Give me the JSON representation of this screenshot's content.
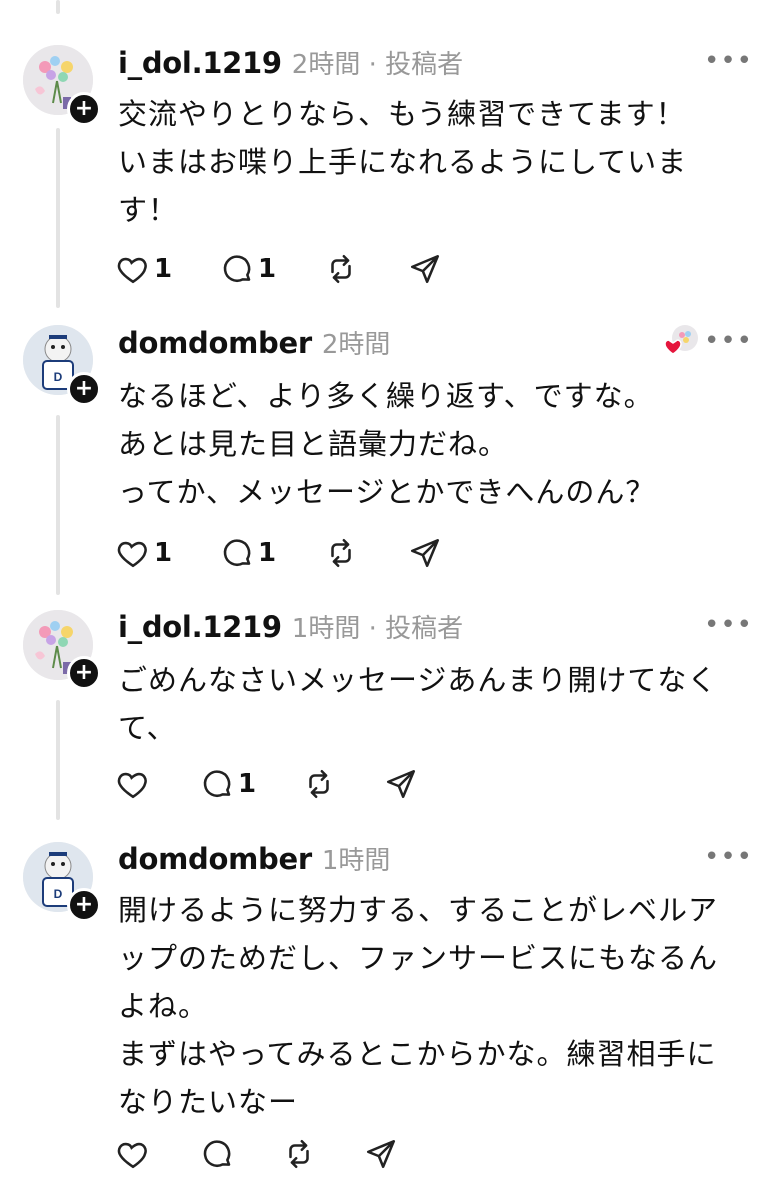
{
  "posts": [
    {
      "username": "i_dol.1219",
      "meta": "2時間 · 投稿者",
      "text": "交流やりとりなら、もう練習できてます！\nいまはお喋り上手になれるようにしていま\nす！",
      "likes": "1",
      "replies": "1",
      "avatar": "bouquet-avatar"
    },
    {
      "username": "domdomber",
      "meta": "2時間",
      "text": "なるほど、より多く繰り返す、ですな。\nあとは見た目と語彙力だね。\nってか、メッセージとかできへんのん？",
      "likes": "1",
      "replies": "1",
      "avatar": "mascot-avatar",
      "liked_by_author": true
    },
    {
      "username": "i_dol.1219",
      "meta": "1時間 · 投稿者",
      "text": "ごめんなさいメッセージあんまり開けてなく\nて、",
      "likes": "",
      "replies": "1",
      "avatar": "bouquet-avatar"
    },
    {
      "username": "domdomber",
      "meta": "1時間",
      "text": "開けるように努力する、することがレベルア\nップのためだし、ファンサービスにもなるん\nよね。\nまずはやってみるとこからかな。練習相手に\nなりたいなー",
      "likes": "",
      "replies": "",
      "avatar": "mascot-avatar"
    }
  ],
  "colors": {
    "text": "#111111",
    "meta": "#999999",
    "thread_line": "#e3e3e3",
    "heart_red": "#e5163d"
  }
}
